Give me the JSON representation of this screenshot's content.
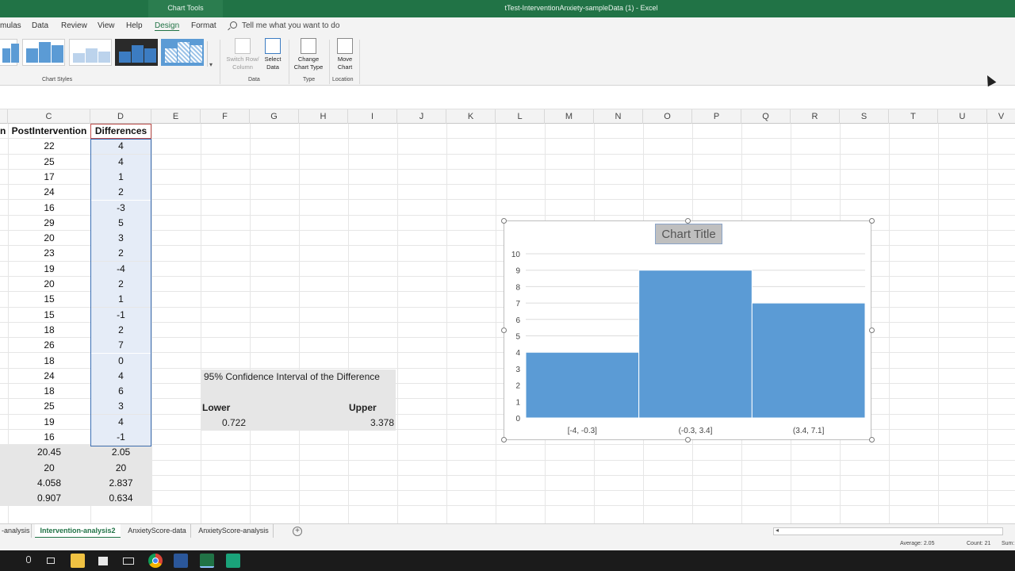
{
  "titlebar": {
    "contextual_tab": "Chart Tools",
    "document_title": "tTest-InterventionAnxiety-sampleData (1)  -  Excel"
  },
  "ribbon_tabs": {
    "formulas": "mulas",
    "data": "Data",
    "review": "Review",
    "view": "View",
    "help": "Help",
    "design": "Design",
    "format": "Format",
    "tell_me": "Tell me what you want to do"
  },
  "ribbon": {
    "chart_styles_label": "Chart Styles",
    "switch_row_column": "Switch Row/\nColumn",
    "select_data": "Select\nData",
    "data_label": "Data",
    "change_chart_type": "Change\nChart Type",
    "type_label": "Type",
    "move_chart": "Move\nChart",
    "location_label": "Location"
  },
  "columns": [
    "C",
    "D",
    "E",
    "F",
    "G",
    "H",
    "I",
    "J",
    "K",
    "L",
    "M",
    "N",
    "O",
    "P",
    "Q",
    "R",
    "S",
    "T",
    "U",
    "V"
  ],
  "sheet": {
    "b_header_fragment": "n",
    "c_header": "PostIntervention",
    "d_header": "Differences",
    "post_intervention": [
      "22",
      "25",
      "17",
      "24",
      "16",
      "29",
      "20",
      "23",
      "19",
      "20",
      "15",
      "15",
      "18",
      "26",
      "18",
      "24",
      "18",
      "25",
      "19",
      "16"
    ],
    "differences": [
      "4",
      "4",
      "1",
      "2",
      "-3",
      "5",
      "3",
      "2",
      "-4",
      "2",
      "1",
      "-1",
      "2",
      "7",
      "0",
      "4",
      "6",
      "3",
      "4",
      "-1"
    ],
    "stats_c": [
      "20.45",
      "20",
      "4.058",
      "0.907"
    ],
    "stats_d": [
      "2.05",
      "20",
      "2.837",
      "0.634"
    ]
  },
  "ci": {
    "title": "95% Confidence Interval of the Difference",
    "lower_label": "Lower",
    "upper_label": "Upper",
    "lower_value": "0.722",
    "upper_value": "3.378"
  },
  "chart_data": {
    "type": "bar",
    "title": "Chart Title",
    "categories": [
      "[-4, -0.3]",
      "(-0.3, 3.4]",
      "(3.4, 7.1]"
    ],
    "values": [
      4,
      9,
      7
    ],
    "ylim": [
      0,
      10
    ],
    "yticks": [
      "0",
      "1",
      "2",
      "3",
      "4",
      "5",
      "6",
      "7",
      "8",
      "9",
      "10"
    ],
    "grid": true,
    "bar_color": "#5b9bd5"
  },
  "sheet_tabs": {
    "tab1": "-analysis",
    "tab2": "Intervention-analysis2",
    "tab3": "AnxietyScore-data",
    "tab4": "AnxietyScore-analysis"
  },
  "status": {
    "average": "Average: 2.05",
    "count": "Count: 21",
    "sum": "Sum:"
  },
  "colors": {
    "excel_green": "#217346",
    "selection_fill": "#e5ecf7",
    "stats_fill": "#e6e6e6"
  }
}
